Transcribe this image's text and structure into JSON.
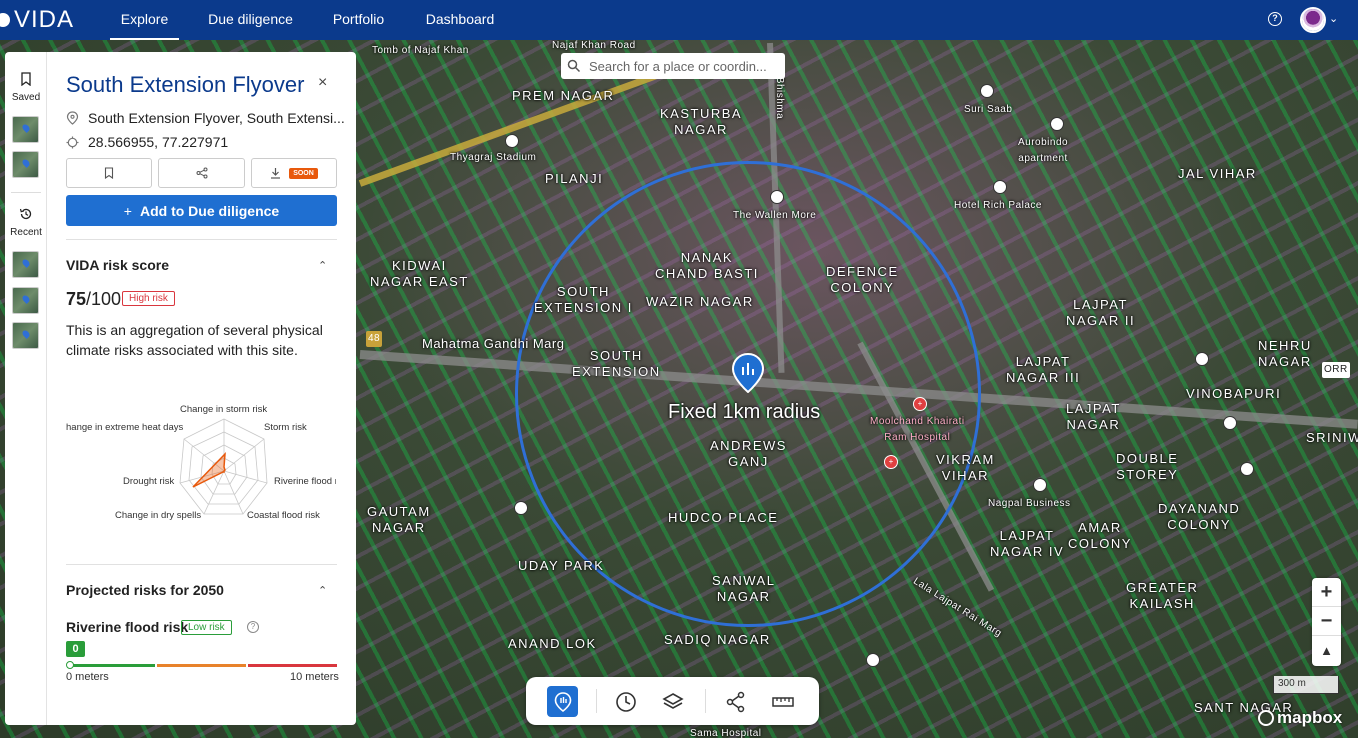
{
  "nav": {
    "logo": "VIDA",
    "tabs": [
      "Explore",
      "Due diligence",
      "Portfolio",
      "Dashboard"
    ],
    "active_tab": "Explore",
    "help_icon": "?"
  },
  "search": {
    "placeholder": "Search for a place or coordin..."
  },
  "rail": {
    "saved_label": "Saved",
    "recent_label": "Recent"
  },
  "panel": {
    "title": "South Extension Flyover",
    "close": "×",
    "address": "South Extension Flyover, South Extensi...",
    "coordinates": "28.566955, 77.227971",
    "soon_badge": "SOON",
    "add_button": "Add to Due diligence",
    "risk_section": "VIDA risk score",
    "score_value": "75",
    "score_max": "/100",
    "risk_badge": "High risk",
    "description": "This is an aggregation of several physical climate risks associated with this site.",
    "radar_labels": {
      "top": "Change in storm risk",
      "top_left": "hange in extreme heat days",
      "top_right": "Storm risk",
      "left": "Drought risk",
      "right": "Riverine flood r",
      "bottom_left": "Change in dry spells",
      "bottom_right": "Coastal flood risk"
    },
    "projected_section": "Projected risks for 2050",
    "flood_label": "Riverine flood risk",
    "flood_badge": "Low risk",
    "flood_value": "0",
    "scale_min": "0 meters",
    "scale_max": "10 meters"
  },
  "map": {
    "labels": {
      "tomb": "Tomb of Najaf Khan",
      "najaf_road": "Najaf Khan Road",
      "prem_nagar": "PREM NAGAR",
      "kasturba": "KASTURBA\nNAGAR",
      "bhishma": "Bhishma",
      "thyagraj": "Thyagraj Stadium",
      "pilanji": "PILANJI",
      "suri_saab": "Suri Saab",
      "aurobindo": "Aurobindo\napartment",
      "jal_vihar": "JAL VIHAR",
      "hotel": "Hotel Rich Palace",
      "wallen_more": "The Wallen More",
      "kidwai": "KIDWAI\nNAGAR EAST",
      "nanak": "NANAK\nCHAND BASTI",
      "defence": "DEFENCE\nCOLONY",
      "wazir": "WAZIR NAGAR",
      "south_ext_1": "SOUTH\nEXTENSION I",
      "lajpat_2": "LAJPAT\nNAGAR II",
      "nehru": "NEHRU\nNAGAR",
      "mahatma": "Mahatma Gandhi Marg",
      "south_ext": "SOUTH\nEXTENSION",
      "lajpat_3": "LAJPAT\nNAGAR III",
      "vinobapuri": "VINOBAPURI",
      "lajpat_nagar": "LAJPAT\nNAGAR",
      "andrews": "ANDREWS\nGANJ",
      "moolchand": "Moolchand Khairati\nRam Hospital",
      "vikram": "VIKRAM\nVIHAR",
      "double": "DOUBLE\nSTOREY",
      "gautam": "GAUTAM\nNAGAR",
      "hudco": "HUDCO PLACE",
      "nagpal": "Nagpal Business",
      "dayanand": "DAYANAND\nCOLONY",
      "lajpat_4": "LAJPAT\nNAGAR IV",
      "amar": "AMAR\nCOLONY",
      "uday": "UDAY PARK",
      "sanwal": "SANWAL\nNAGAR",
      "greater": "GREATER\nKAILASH",
      "anand": "ANAND LOK",
      "sadiq": "SADIQ NAGAR",
      "lala": "Lala Lajpat Rai Marg",
      "sant": "SANT NAGAR",
      "sama": "Sama Hospital",
      "orr": "ORR",
      "srini": "SRINIW",
      "route48": "48"
    },
    "radius_label": "Fixed 1km radius",
    "scale": "300 m",
    "attribution": "mapbox",
    "zoom_in": "+",
    "zoom_out": "−",
    "compass": "▲"
  },
  "colors": {
    "nav": "#0b3a8c",
    "accent": "#1f6fd1",
    "high_risk": "#d9363e",
    "low_risk": "#2a9d3a",
    "radius": "#2f6fd6"
  },
  "radar_data": {
    "axes": [
      "Change in storm risk",
      "Storm risk",
      "Riverine flood risk",
      "Coastal flood risk",
      "Change in dry spells",
      "Drought risk",
      "Change in extreme heat days"
    ]
  },
  "icons": {
    "saved": "bookmark-icon",
    "recent": "history-icon",
    "location": "pin-icon",
    "coords": "crosshair-icon",
    "bookmark": "bookmark-icon",
    "share": "share-icon",
    "download": "download-icon",
    "plus": "plus-icon",
    "search": "search-icon"
  }
}
